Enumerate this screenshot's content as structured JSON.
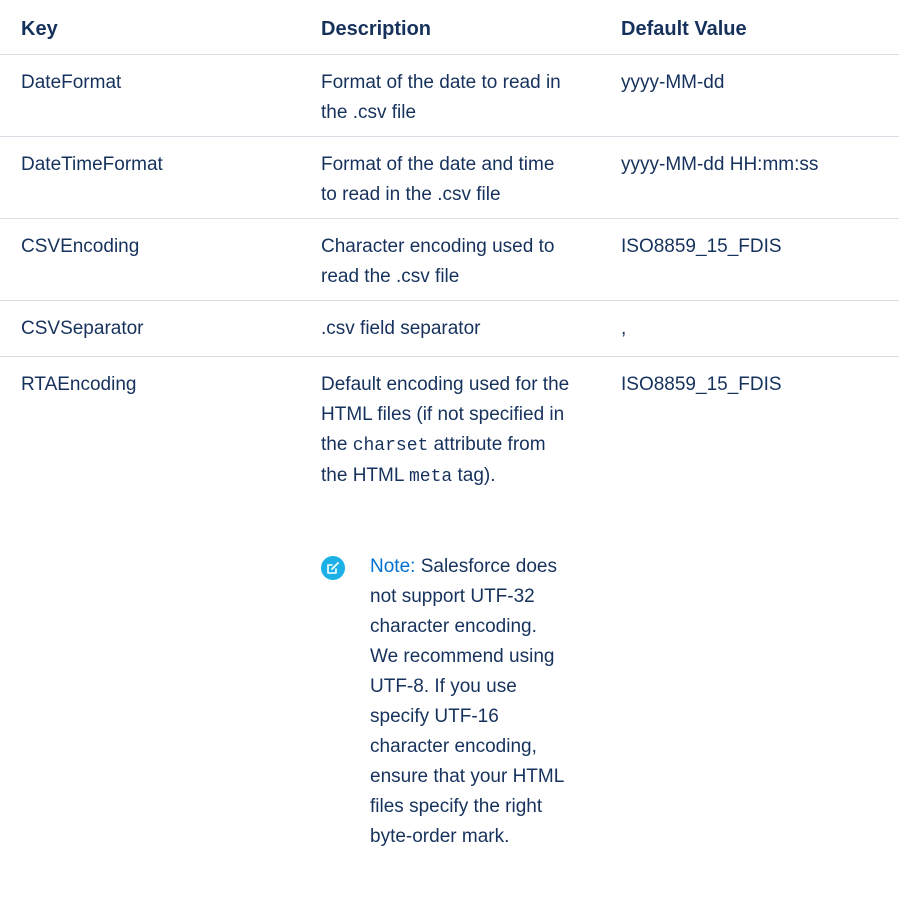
{
  "headers": {
    "key": "Key",
    "description": "Description",
    "default": "Default Value"
  },
  "rows": [
    {
      "key": "DateFormat",
      "description_line1": "Format of the date to read in",
      "description_line2": "the .csv file",
      "default": "yyyy-MM-dd"
    },
    {
      "key": "DateTimeFormat",
      "description_line1": "Format of the date and time",
      "description_line2": "to read in the .csv file",
      "default": "yyyy-MM-dd HH:mm:ss"
    },
    {
      "key": "CSVEncoding",
      "description_line1": "Character encoding used to",
      "description_line2": "read the .csv file",
      "default": "ISO8859_15_FDIS"
    },
    {
      "key": "CSVSeparator",
      "description_line1": ".csv field separator",
      "default": ","
    },
    {
      "key": "RTAEncoding",
      "description_line1": "Default encoding used for the",
      "description_line2": "HTML files (if not specified in",
      "description_line3_pre": "the",
      "description_line3_code": "charset",
      "description_line3_post": "attribute from",
      "description_line4_pre": "the HTML",
      "description_line4_code": "meta",
      "description_line4_post": "tag).",
      "default": "ISO8859_15_FDIS"
    }
  ],
  "note": {
    "label": "Note:",
    "icon": "edit-note-icon",
    "icon_color": "#1bb1e6",
    "lines": [
      "Salesforce does",
      "not support UTF-32",
      "character encoding.",
      "We recommend using",
      "UTF-8. If you use",
      "specify UTF-16",
      "character encoding,",
      "ensure that your HTML",
      "files specify the right",
      "byte-order mark."
    ]
  }
}
